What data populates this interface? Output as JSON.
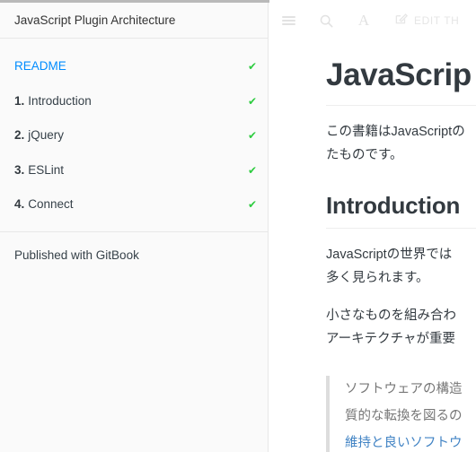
{
  "sidebar": {
    "book_title": "JavaScript Plugin Architecture",
    "items": [
      {
        "num": "",
        "label": "README",
        "active": true,
        "check": "✔"
      },
      {
        "num": "1.",
        "label": "Introduction",
        "active": false,
        "check": "✔"
      },
      {
        "num": "2.",
        "label": "jQuery",
        "active": false,
        "check": "✔"
      },
      {
        "num": "3.",
        "label": "ESLint",
        "active": false,
        "check": "✔"
      },
      {
        "num": "4.",
        "label": "Connect",
        "active": false,
        "check": "✔"
      }
    ],
    "footer": "Published with GitBook"
  },
  "toolbar": {
    "menu_icon": "hamburger-menu-icon",
    "search_icon": "search-icon",
    "font_icon": "A",
    "edit_icon": "edit-pencil-icon",
    "edit_label": "EDIT TH"
  },
  "content": {
    "title": "JavaScrip",
    "paragraph1_line1": "この書籍はJavaScriptの",
    "paragraph1_line2": "たものです。",
    "heading2": "Introduction",
    "paragraph2_line1": "JavaScriptの世界では",
    "paragraph2_line2": "多く見られます。",
    "paragraph3_line1": "小さなものを組み合わ",
    "paragraph3_line2": "アーキテクチャが重要",
    "quote_line1": "ソフトウェアの構造",
    "quote_line2": "質的な転換を図るの",
    "quote_line3": "維持と良いソフトウ"
  },
  "colors": {
    "accent_link": "#008cff",
    "check_green": "#2ecc40",
    "quote_link": "#4183c4",
    "sidebar_bg": "#fafafa",
    "text": "#333a40"
  }
}
